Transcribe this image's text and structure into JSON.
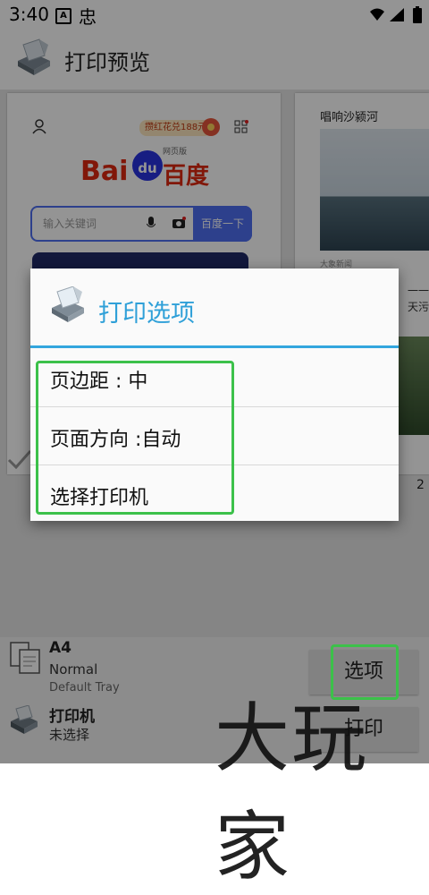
{
  "status_bar": {
    "time": "3:40",
    "icon_a": "A",
    "icon_bug": "忠"
  },
  "app_bar": {
    "title": "打印预览"
  },
  "preview": {
    "page1": {
      "badge": "攒红花兑188元",
      "logo_sub": "网页版",
      "search_placeholder": "输入关键词",
      "search_button": "百度一下"
    },
    "page2": {
      "headline": "唱响沙颍河",
      "source": "大象新闻",
      "side_text_1": "一一",
      "side_text_2": "天污"
    },
    "page_number": "2"
  },
  "bottom": {
    "paper_size": "A4",
    "paper_margin": "Normal",
    "paper_tray": "Default Tray",
    "printer_label": "打印机",
    "printer_value": "未选择",
    "options_button": "选项",
    "print_button": "打印"
  },
  "dialog": {
    "title": "打印选项",
    "options": [
      {
        "label": "页边距 : 中"
      },
      {
        "label": "页面方向 :自动"
      },
      {
        "label": "选择打印机"
      }
    ]
  },
  "watermark": "大玩家",
  "colors": {
    "accent": "#2fa0d8",
    "highlight": "#3cc14a",
    "baidu_red": "#de2910",
    "baidu_blue": "#2932e1"
  }
}
